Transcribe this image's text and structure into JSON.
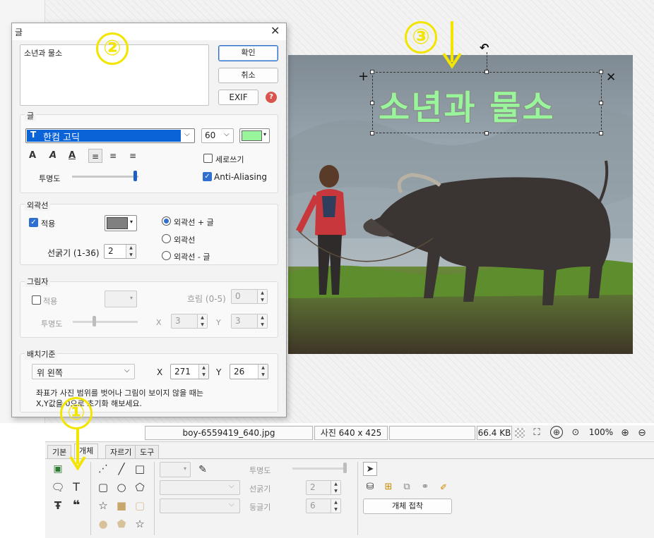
{
  "dialog": {
    "title": "글",
    "text_content": "소년과 물소",
    "ok_label": "확인",
    "cancel_label": "취소",
    "exif_label": "EXIF",
    "text_group": {
      "label": "글",
      "font_name": "한컴 고딕",
      "font_size": "60",
      "font_color": "#99f59b",
      "vertical_label": "세로쓰기",
      "vertical_checked": false,
      "opacity_label": "투명도",
      "opacity_level": 1.0,
      "antialias_label": "Anti-Aliasing",
      "antialias_checked": true
    },
    "outline_group": {
      "label": "외곽선",
      "apply_label": "적용",
      "apply_checked": true,
      "color": "#808080",
      "width_label": "선굵기 (1-36)",
      "width_value": "2",
      "options": [
        "외곽선 + 글",
        "외곽선",
        "외곽선 - 글"
      ],
      "selected": "외곽선 + 글"
    },
    "shadow_group": {
      "label": "그림자",
      "apply_label": "적용",
      "apply_checked": false,
      "blur_label": "흐림 (0-5)",
      "blur_value": "0",
      "opacity_label": "투명도",
      "x_label": "X",
      "x_value": "3",
      "y_label": "Y",
      "y_value": "3"
    },
    "position_group": {
      "label": "배치기준",
      "anchor": "위 왼쪽",
      "x_label": "X",
      "x_value": "271",
      "y_label": "Y",
      "y_value": "26",
      "note_line1": "좌표가 사진 범위를 벗어나 그림이 보이지 않을 때는",
      "note_line2": "X,Y값을 0으로 초기화 해보세요."
    }
  },
  "canvas": {
    "overlay_text": "소년과 물소",
    "overlay_color": "#99f59b"
  },
  "annotations": {
    "n1": "①",
    "n2": "②",
    "n3": "③",
    "color": "#f2e500"
  },
  "statusbar": {
    "filename": "boy-6559419_640.jpg",
    "dimensions": "사진 640 x 425",
    "filesize": "66.4 KB",
    "zoom": "100%"
  },
  "bottom": {
    "tabs": [
      "기본",
      "개체",
      "자르기",
      "도구"
    ],
    "active_tab": "개체",
    "opacity_label": "투명도",
    "stroke_label": "선굵기",
    "stroke_value": "2",
    "round_label": "둥글기",
    "round_value": "6",
    "merge_button": "개체 접착"
  }
}
